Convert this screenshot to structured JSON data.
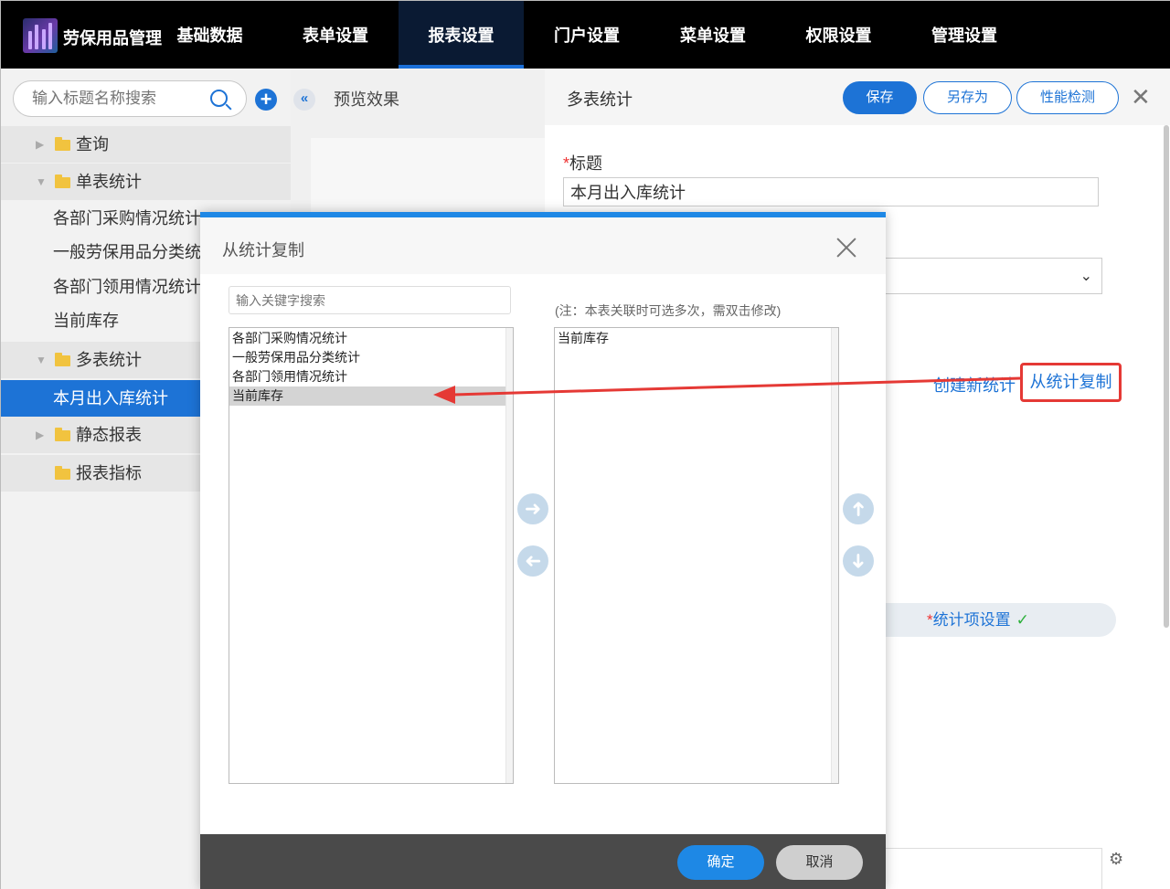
{
  "app": {
    "title": "劳保用品管理"
  },
  "nav": {
    "items": [
      {
        "label": "基础数据"
      },
      {
        "label": "表单设置"
      },
      {
        "label": "报表设置"
      },
      {
        "label": "门户设置"
      },
      {
        "label": "菜单设置"
      },
      {
        "label": "权限设置"
      },
      {
        "label": "管理设置"
      }
    ],
    "active_index": 2
  },
  "sidebar": {
    "search_placeholder": "输入标题名称搜索",
    "tree": [
      {
        "label": "查询",
        "type": "folder",
        "expanded": false
      },
      {
        "label": "单表统计",
        "type": "folder",
        "expanded": true
      },
      {
        "label": "各部门采购情况统计",
        "type": "leaf"
      },
      {
        "label": "一般劳保用品分类统计",
        "type": "leaf"
      },
      {
        "label": "各部门领用情况统计",
        "type": "leaf"
      },
      {
        "label": "当前库存",
        "type": "leaf"
      },
      {
        "label": "多表统计",
        "type": "folder",
        "expanded": true
      },
      {
        "label": "本月出入库统计",
        "type": "leaf",
        "selected": true
      },
      {
        "label": "静态报表",
        "type": "folder",
        "expanded": false
      },
      {
        "label": "报表指标",
        "type": "folder",
        "expanded": false
      }
    ]
  },
  "preview": {
    "title": "预览效果"
  },
  "panel": {
    "title": "多表统计",
    "buttons": {
      "save": "保存",
      "save_as": "另存为",
      "perf": "性能检测"
    },
    "title_field_label": "标题",
    "title_value": "本月出入库统计",
    "link_create": "创建新统计",
    "link_copy": "从统计复制",
    "stat_tab": "统计项设置"
  },
  "modal": {
    "title": "从统计复制",
    "search_placeholder": "输入关键字搜索",
    "note": "(注：本表关联时可选多次，需双击修改)",
    "left_options": [
      {
        "label": "各部门采购情况统计"
      },
      {
        "label": "一般劳保用品分类统计"
      },
      {
        "label": "各部门领用情况统计"
      },
      {
        "label": "当前库存",
        "selected": true
      }
    ],
    "right_options": [
      {
        "label": "当前库存"
      }
    ],
    "ok": "确定",
    "cancel": "取消"
  },
  "colors": {
    "accent": "#1d73d6",
    "annotation": "#e53935"
  }
}
